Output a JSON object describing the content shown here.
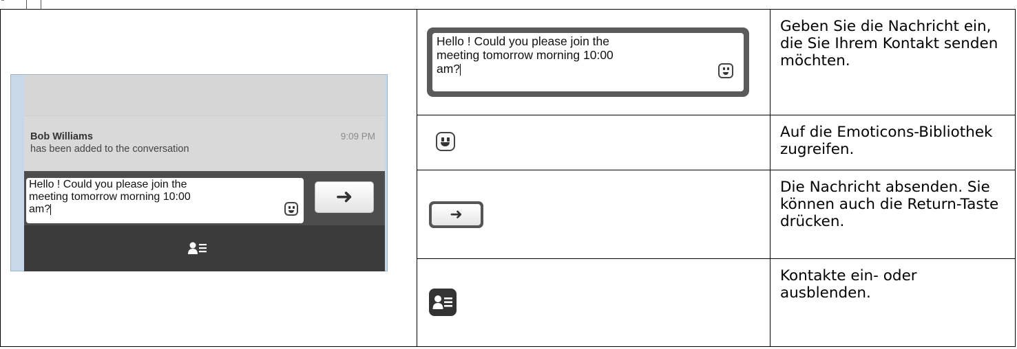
{
  "chat_window": {
    "message": {
      "sender": "Bob Williams",
      "time": "9:09 PM",
      "text": "has been added to the conversation"
    },
    "input_value_lines": [
      "Hello ! Could you please join the",
      "meeting tomorrow morning 10:00",
      "am?"
    ],
    "icons": {
      "emoticon": "smiley-icon",
      "send": "arrow-right-icon",
      "contacts": "contacts-toggle-icon"
    }
  },
  "table": {
    "rows": [
      {
        "icon": "message-input-field",
        "description": "Geben Sie die Nachricht ein, die Sie Ihrem Kontakt senden möchten."
      },
      {
        "icon": "smiley-icon",
        "description": "Auf die Emoticons-Bibliothek zugreifen."
      },
      {
        "icon": "send-button",
        "description": "Die Nachricht absenden. Sie können auch die Return-Taste drücken."
      },
      {
        "icon": "contacts-toggle-icon",
        "description": "Kontakte ein- oder ausblenden."
      }
    ]
  },
  "colors": {
    "dark_bar": "#4d4d4d",
    "footer_bar": "#3b3b3b",
    "window_frame": "#c9d8e6"
  }
}
